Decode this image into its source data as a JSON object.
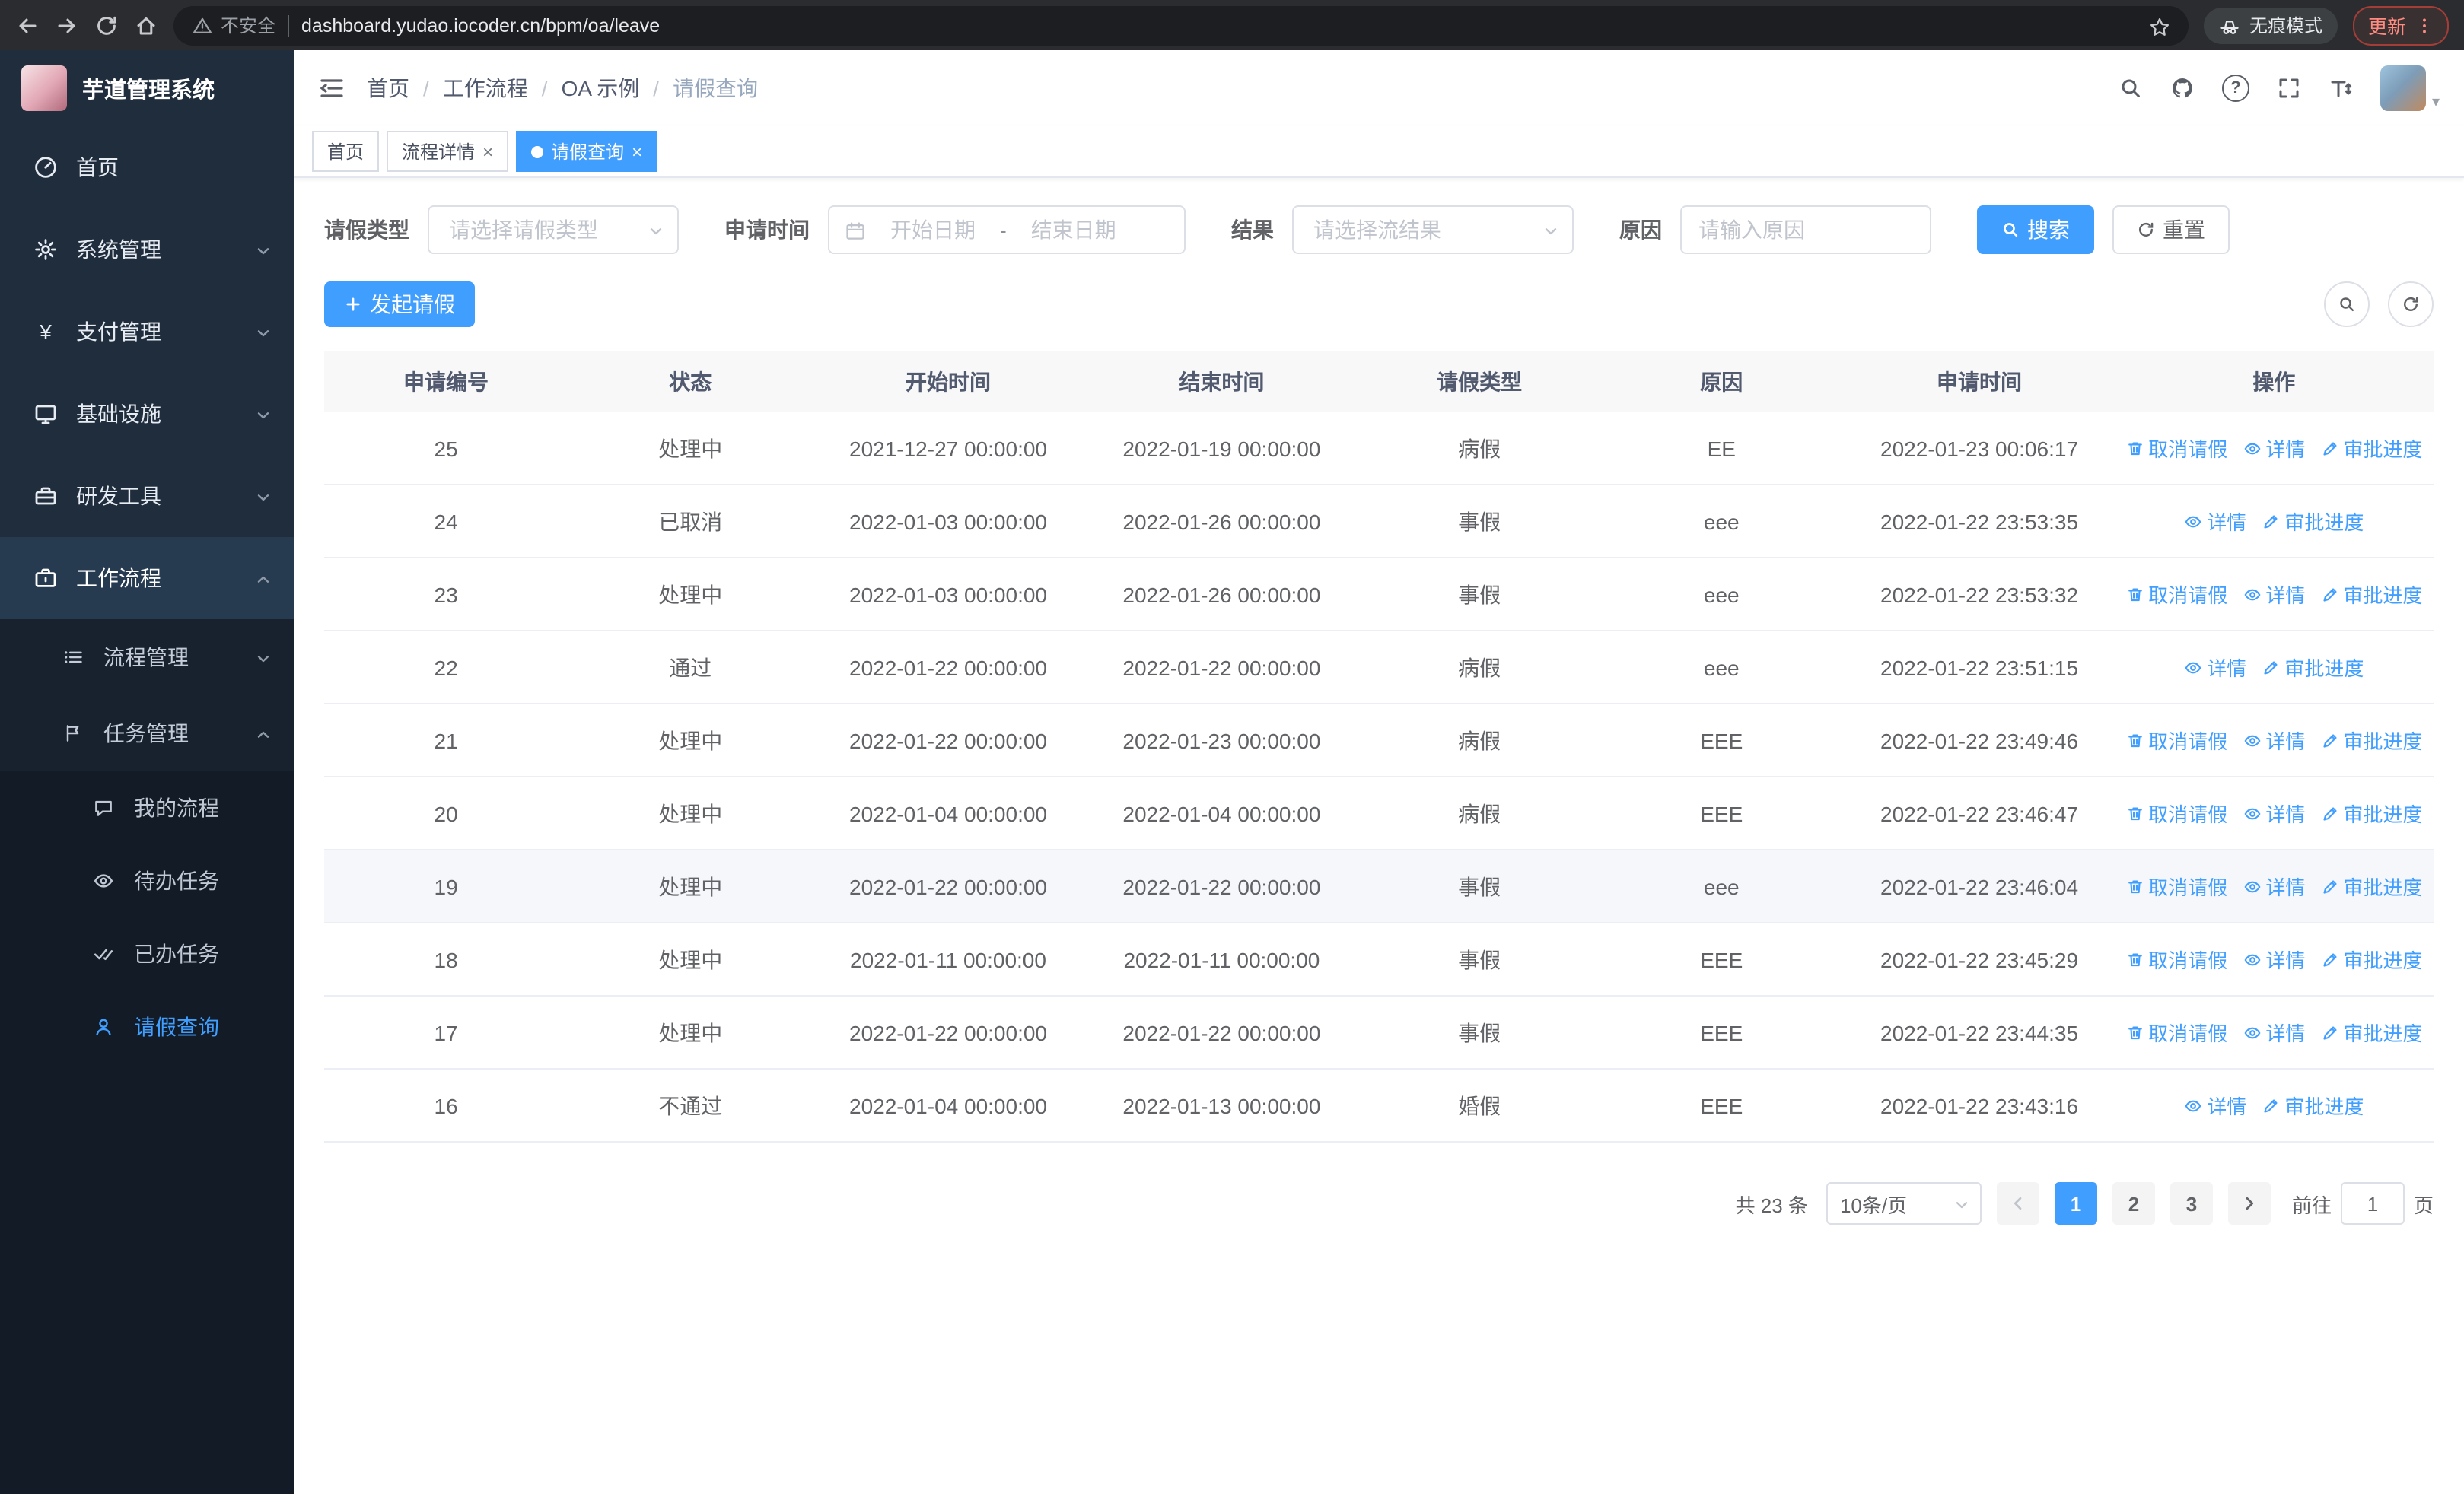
{
  "colors": {
    "primary": "#409eff",
    "sidebar_bg": "#1f2d3d",
    "active_tag_bg": "#409eff"
  },
  "browser": {
    "security_warning": "不安全",
    "url": "dashboard.yudao.iocoder.cn/bpm/oa/leave",
    "incognito_label": "无痕模式",
    "update_label": "更新"
  },
  "sidebar": {
    "logo_title": "芋道管理系统",
    "items": [
      {
        "label": "首页",
        "icon": "dashboard-icon",
        "level": 1
      },
      {
        "label": "系统管理",
        "icon": "gear-icon",
        "level": 1,
        "expanded": false
      },
      {
        "label": "支付管理",
        "icon": "yen-icon",
        "level": 1,
        "expanded": false
      },
      {
        "label": "基础设施",
        "icon": "monitor-icon",
        "level": 1,
        "expanded": false
      },
      {
        "label": "研发工具",
        "icon": "toolbox-icon",
        "level": 1,
        "expanded": false
      },
      {
        "label": "工作流程",
        "icon": "briefcase-icon",
        "level": 1,
        "expanded": true
      },
      {
        "label": "流程管理",
        "icon": "list-icon",
        "level": 2,
        "expanded": false
      },
      {
        "label": "任务管理",
        "icon": "flag-icon",
        "level": 2,
        "expanded": true
      },
      {
        "label": "我的流程",
        "icon": "chat-icon",
        "level": 3
      },
      {
        "label": "待办任务",
        "icon": "eye-icon",
        "level": 3
      },
      {
        "label": "已办任务",
        "icon": "double-check-icon",
        "level": 3
      },
      {
        "label": "请假查询",
        "icon": "user-icon",
        "level": 3,
        "active": true
      }
    ]
  },
  "header": {
    "breadcrumb": [
      "首页",
      "工作流程",
      "OA 示例",
      "请假查询"
    ],
    "separator": "/"
  },
  "tabs": [
    {
      "label": "首页",
      "closable": false,
      "active": false
    },
    {
      "label": "流程详情",
      "closable": true,
      "active": false
    },
    {
      "label": "请假查询",
      "closable": true,
      "active": true
    }
  ],
  "filters": {
    "leave_type_label": "请假类型",
    "leave_type_placeholder": "请选择请假类型",
    "apply_time_label": "申请时间",
    "start_date_placeholder": "开始日期",
    "range_separator": "-",
    "end_date_placeholder": "结束日期",
    "result_label": "结果",
    "result_placeholder": "请选择流结果",
    "reason_label": "原因",
    "reason_placeholder": "请输入原因",
    "search_label": "搜索",
    "reset_label": "重置"
  },
  "toolbar": {
    "create_label": "发起请假"
  },
  "table": {
    "headers": [
      "申请编号",
      "状态",
      "开始时间",
      "结束时间",
      "请假类型",
      "原因",
      "申请时间",
      "操作"
    ],
    "action_labels": {
      "cancel": "取消请假",
      "detail": "详情",
      "progress": "审批进度"
    },
    "rows": [
      {
        "id": "25",
        "status": "处理中",
        "start": "2021-12-27 00:00:00",
        "end": "2022-01-19 00:00:00",
        "type": "病假",
        "reason": "EE",
        "applied": "2022-01-23 00:06:17",
        "actions": [
          "cancel",
          "detail",
          "progress"
        ],
        "highlighted": false
      },
      {
        "id": "24",
        "status": "已取消",
        "start": "2022-01-03 00:00:00",
        "end": "2022-01-26 00:00:00",
        "type": "事假",
        "reason": "eee",
        "applied": "2022-01-22 23:53:35",
        "actions": [
          "detail",
          "progress"
        ],
        "highlighted": false
      },
      {
        "id": "23",
        "status": "处理中",
        "start": "2022-01-03 00:00:00",
        "end": "2022-01-26 00:00:00",
        "type": "事假",
        "reason": "eee",
        "applied": "2022-01-22 23:53:32",
        "actions": [
          "cancel",
          "detail",
          "progress"
        ],
        "highlighted": false
      },
      {
        "id": "22",
        "status": "通过",
        "start": "2022-01-22 00:00:00",
        "end": "2022-01-22 00:00:00",
        "type": "病假",
        "reason": "eee",
        "applied": "2022-01-22 23:51:15",
        "actions": [
          "detail",
          "progress"
        ],
        "highlighted": false
      },
      {
        "id": "21",
        "status": "处理中",
        "start": "2022-01-22 00:00:00",
        "end": "2022-01-23 00:00:00",
        "type": "病假",
        "reason": "EEE",
        "applied": "2022-01-22 23:49:46",
        "actions": [
          "cancel",
          "detail",
          "progress"
        ],
        "highlighted": false
      },
      {
        "id": "20",
        "status": "处理中",
        "start": "2022-01-04 00:00:00",
        "end": "2022-01-04 00:00:00",
        "type": "病假",
        "reason": "EEE",
        "applied": "2022-01-22 23:46:47",
        "actions": [
          "cancel",
          "detail",
          "progress"
        ],
        "highlighted": false
      },
      {
        "id": "19",
        "status": "处理中",
        "start": "2022-01-22 00:00:00",
        "end": "2022-01-22 00:00:00",
        "type": "事假",
        "reason": "eee",
        "applied": "2022-01-22 23:46:04",
        "actions": [
          "cancel",
          "detail",
          "progress"
        ],
        "highlighted": true
      },
      {
        "id": "18",
        "status": "处理中",
        "start": "2022-01-11 00:00:00",
        "end": "2022-01-11 00:00:00",
        "type": "事假",
        "reason": "EEE",
        "applied": "2022-01-22 23:45:29",
        "actions": [
          "cancel",
          "detail",
          "progress"
        ],
        "highlighted": false
      },
      {
        "id": "17",
        "status": "处理中",
        "start": "2022-01-22 00:00:00",
        "end": "2022-01-22 00:00:00",
        "type": "事假",
        "reason": "EEE",
        "applied": "2022-01-22 23:44:35",
        "actions": [
          "cancel",
          "detail",
          "progress"
        ],
        "highlighted": false
      },
      {
        "id": "16",
        "status": "不通过",
        "start": "2022-01-04 00:00:00",
        "end": "2022-01-13 00:00:00",
        "type": "婚假",
        "reason": "EEE",
        "applied": "2022-01-22 23:43:16",
        "actions": [
          "detail",
          "progress"
        ],
        "highlighted": false
      }
    ]
  },
  "pagination": {
    "total_text": "共 23 条",
    "page_size": "10条/页",
    "pages": [
      "1",
      "2",
      "3"
    ],
    "active_page": "1",
    "goto_prefix": "前往",
    "goto_value": "1",
    "goto_suffix": "页"
  }
}
